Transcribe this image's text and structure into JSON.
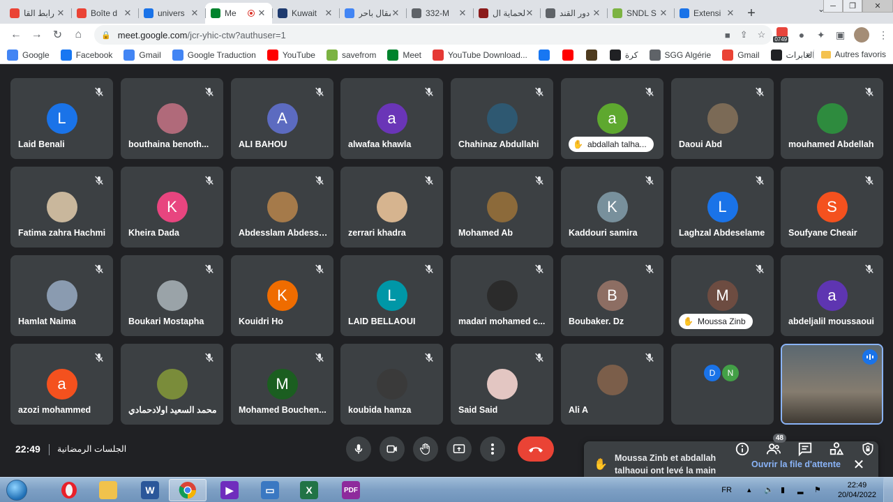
{
  "tabs": [
    {
      "title": "رابط القا",
      "icon": "gmail-icon",
      "color": "#ea4335",
      "active": false
    },
    {
      "title": "Boîte d",
      "icon": "gmail-icon",
      "color": "#ea4335",
      "active": false
    },
    {
      "title": "univers",
      "icon": "calendar-icon",
      "color": "#1a73e8",
      "active": false
    },
    {
      "title": "Me",
      "icon": "meet-icon",
      "color": "#00832d",
      "active": true
    },
    {
      "title": "Kuwait",
      "icon": "kuwait-icon",
      "color": "#1e3a6e",
      "active": false
    },
    {
      "title": "مقال باحر",
      "icon": "google-icon",
      "color": "#4285f4",
      "active": false
    },
    {
      "title": "332-M",
      "icon": "globe-icon",
      "color": "#5f6368",
      "active": false
    },
    {
      "title": "الحماية ال",
      "icon": "pkp-icon",
      "color": "#8b1a1a",
      "active": false
    },
    {
      "title": "دور القند",
      "icon": "globe-icon",
      "color": "#5f6368",
      "active": false
    },
    {
      "title": "SNDL S",
      "icon": "sndl-icon",
      "color": "#7cb342",
      "active": false
    },
    {
      "title": "Extensi",
      "icon": "puzzle-icon",
      "color": "#1a73e8",
      "active": false
    }
  ],
  "browser": {
    "url_host": "meet.google.com",
    "url_path": "/jcr-yhic-ctw?authuser=1",
    "ext_badge": "0749"
  },
  "bookmarks": [
    {
      "label": "Google",
      "icon": "google-icon",
      "color": "#4285f4"
    },
    {
      "label": "Facebook",
      "icon": "facebook-icon",
      "color": "#1877f2"
    },
    {
      "label": "Gmail",
      "icon": "google-icon",
      "color": "#4285f4"
    },
    {
      "label": "Google Traduction",
      "icon": "translate-icon",
      "color": "#4285f4"
    },
    {
      "label": "YouTube",
      "icon": "youtube-icon",
      "color": "#ff0000"
    },
    {
      "label": "savefrom",
      "icon": "download-arrow-icon",
      "color": "#7cb342"
    },
    {
      "label": "Meet",
      "icon": "meet-icon",
      "color": "#00832d"
    },
    {
      "label": "YouTube Download...",
      "icon": "youtube-download-icon",
      "color": "#e53935"
    },
    {
      "label": "",
      "icon": "facebook-icon",
      "color": "#1877f2"
    },
    {
      "label": "",
      "icon": "youtube-icon",
      "color": "#ff0000"
    },
    {
      "label": "",
      "icon": "pattern-icon",
      "color": "#4e3b1f"
    },
    {
      "label": "كرة",
      "icon": "quill-icon",
      "color": "#202124"
    },
    {
      "label": "SGG Algérie",
      "icon": "globe-icon",
      "color": "#5f6368"
    },
    {
      "label": "Gmail",
      "icon": "gmail-icon",
      "color": "#ea4335"
    },
    {
      "label": "العابرات",
      "icon": "quill-icon",
      "color": "#202124"
    }
  ],
  "bookmarks_more": "»",
  "bookmarks_other": "Autres favoris",
  "participants": [
    {
      "name": "Laid Benali",
      "initial": "L",
      "avatar_color": "#1a73e8"
    },
    {
      "name": "bouthaina benoth...",
      "initial": "",
      "avatar_color": "#b06a7a"
    },
    {
      "name": "ALI BAHOU",
      "initial": "A",
      "avatar_color": "#5c6bc0"
    },
    {
      "name": "alwafaa khawla",
      "initial": "a",
      "avatar_color": "#6a35b7"
    },
    {
      "name": "Chahinaz Abdullahi",
      "initial": "",
      "avatar_color": "#2e5871"
    },
    {
      "name": "abdallah talha...",
      "initial": "a",
      "avatar_color": "#5ea82f",
      "hand": true
    },
    {
      "name": "Daoui Abd",
      "initial": "",
      "avatar_color": "#7b6a56"
    },
    {
      "name": "mouhamed Abdellah",
      "initial": "",
      "avatar_color": "#2e8b3e"
    },
    {
      "name": "Fatima zahra Hachmi",
      "initial": "",
      "avatar_color": "#c9b79c"
    },
    {
      "name": "Kheira Dada",
      "initial": "K",
      "avatar_color": "#e8457f"
    },
    {
      "name": "Abdesslam Abdessl...",
      "initial": "",
      "avatar_color": "#a57a4a"
    },
    {
      "name": "zerrari khadra",
      "initial": "",
      "avatar_color": "#d6b48f"
    },
    {
      "name": "Mohamed Ab",
      "initial": "",
      "avatar_color": "#8c6a3a"
    },
    {
      "name": "Kaddouri samira",
      "initial": "K",
      "avatar_color": "#78909c"
    },
    {
      "name": "Laghzal Abdeselame",
      "initial": "L",
      "avatar_color": "#1a73e8"
    },
    {
      "name": "Soufyane Cheair",
      "initial": "S",
      "avatar_color": "#f4511e"
    },
    {
      "name": "Hamlat Naima",
      "initial": "",
      "avatar_color": "#8a9bb0"
    },
    {
      "name": "Boukari Mostapha",
      "initial": "",
      "avatar_color": "#9aa3a8"
    },
    {
      "name": "Kouidri Ho",
      "initial": "K",
      "avatar_color": "#ef6c00"
    },
    {
      "name": "LAID BELLAOUI",
      "initial": "L",
      "avatar_color": "#0097a7"
    },
    {
      "name": "madari mohamed c...",
      "initial": "",
      "avatar_color": "#2b2b2b"
    },
    {
      "name": "Boubaker. Dz",
      "initial": "B",
      "avatar_color": "#8d6e63"
    },
    {
      "name": "Moussa Zinb",
      "initial": "M",
      "avatar_color": "#6d4c41",
      "hand": true
    },
    {
      "name": "abdeljalil moussaoui",
      "initial": "a",
      "avatar_color": "#5e35b1"
    },
    {
      "name": "azozi mohammed",
      "initial": "a",
      "avatar_color": "#f4511e"
    },
    {
      "name": "محمد السعيد اولادحمادي",
      "initial": "",
      "avatar_color": "#7a8c3a"
    },
    {
      "name": "Mohamed Bouchen...",
      "initial": "M",
      "avatar_color": "#1b5e20"
    },
    {
      "name": "koubida hamza",
      "initial": "",
      "avatar_color": "#3a3a3a"
    },
    {
      "name": "Said Said",
      "initial": "",
      "avatar_color": "#e3c6c2"
    },
    {
      "name": "Ali A",
      "initial": "",
      "avatar_color": "#7b5e4a"
    }
  ],
  "mini_avatars": [
    {
      "initial": "D",
      "color": "#1a73e8"
    },
    {
      "initial": "N",
      "color": "#43a047"
    }
  ],
  "toast": {
    "message": "Moussa Zinb et abdallah talhaoui ont levé la main",
    "action": "Ouvrir la file d'attente"
  },
  "meeting": {
    "time": "22:49",
    "title": "الجلسات الرمضانية",
    "people_count": "48"
  },
  "taskbar": {
    "lang": "FR",
    "time": "22:49",
    "date": "20/04/2022"
  }
}
